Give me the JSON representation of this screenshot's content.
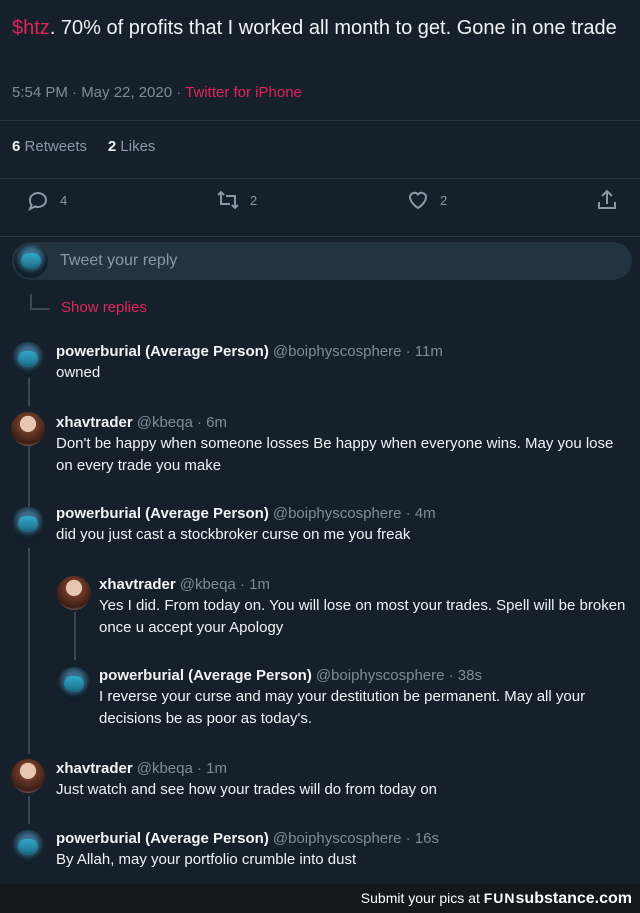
{
  "tweet": {
    "cashtag": "$htz",
    "text": ". 70% of profits that I worked all month to get.  Gone in one trade",
    "time": "5:54 PM · May 22, 2020 · ",
    "source": "Twitter for iPhone",
    "retweets_count": "6",
    "retweets_label": "Retweets",
    "likes_count": "2",
    "likes_label": "Likes"
  },
  "actions": {
    "reply_count": "4",
    "retweet_count": "2",
    "like_count": "2"
  },
  "reply_box": {
    "placeholder": "Tweet your reply"
  },
  "show_replies": "Show replies",
  "replies": [
    {
      "name": "powerburial (Average Person)",
      "meta": "@boiphyscosphere · 11m",
      "text": "owned"
    },
    {
      "name": "xhavtrader",
      "meta": "@kbeqa · 6m",
      "text": "Don't be happy when someone losses   Be happy when everyone wins.  May you lose on every trade you make"
    },
    {
      "name": "powerburial (Average Person)",
      "meta": "@boiphyscosphere · 4m",
      "text": "did you just cast a stockbroker curse on me you freak"
    },
    {
      "name": "xhavtrader",
      "meta": "@kbeqa · 1m",
      "text": "Yes I did.  From today on.  You will lose on most your trades.  Spell will be broken once u accept your Apology"
    },
    {
      "name": "powerburial (Average Person)",
      "meta": "@boiphyscosphere · 38s",
      "text": "I reverse your curse and may your destitution be permanent. May all your decisions be as poor as today's."
    },
    {
      "name": "xhavtrader",
      "meta": "@kbeqa · 1m",
      "text": "Just watch and see how your trades will do from today on"
    },
    {
      "name": "powerburial (Average Person)",
      "meta": "@boiphyscosphere · 16s",
      "text": "By Allah, may your portfolio crumble into dust"
    }
  ],
  "footer": {
    "prefix": "Submit your pics at ",
    "fun": "FUN",
    "brand": "substance.com"
  },
  "colors": {
    "accent": "#e0245e",
    "background": "#15202b"
  }
}
